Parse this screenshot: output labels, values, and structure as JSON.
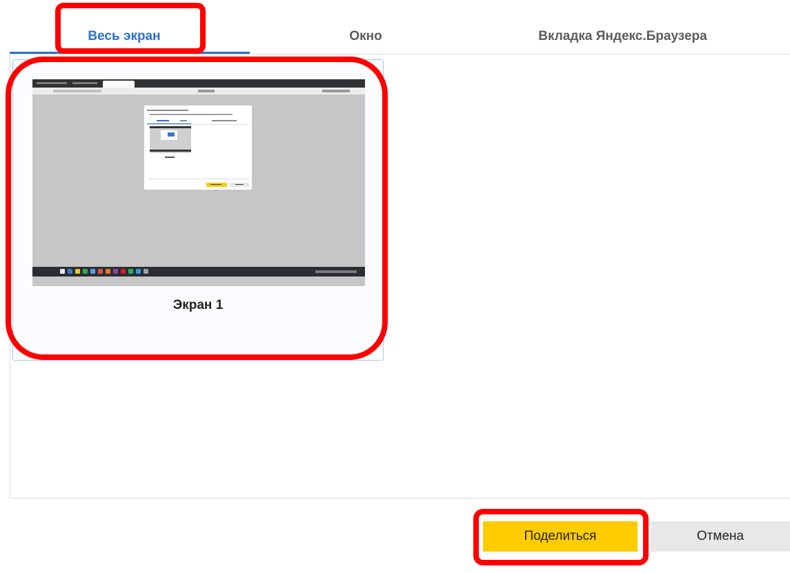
{
  "tabs": [
    {
      "label": "Весь экран",
      "active": true
    },
    {
      "label": "Окно",
      "active": false
    },
    {
      "label": "Вкладка Яндекс.Браузера",
      "active": false
    }
  ],
  "screens": [
    {
      "label": "Экран 1",
      "selected": true
    }
  ],
  "buttons": {
    "share_label": "Поделиться",
    "cancel_label": "Отмена"
  },
  "colors": {
    "accent": "#2b6fcf",
    "share_button": "#ffcc00",
    "cancel_button": "#e8e8e8",
    "annotation": "#ff0000"
  }
}
